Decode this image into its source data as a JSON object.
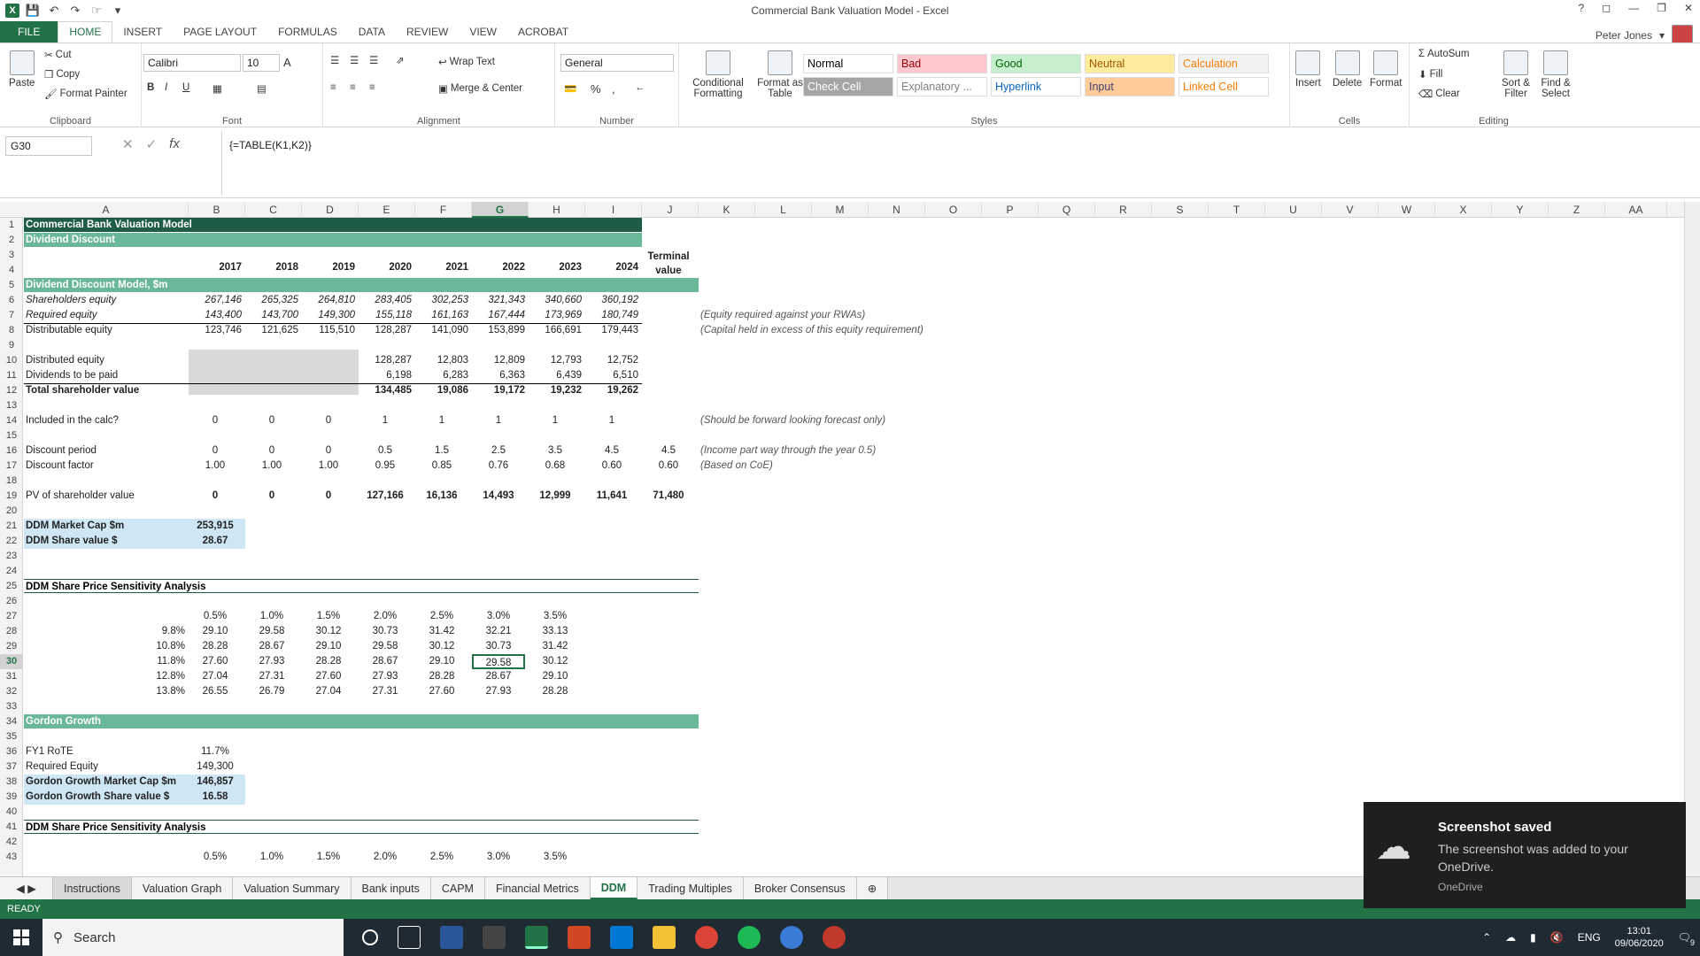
{
  "window": {
    "title": "Commercial Bank Valuation Model - Excel",
    "user": "Peter Jones",
    "help": "?"
  },
  "ribbon_tabs": [
    "FILE",
    "HOME",
    "INSERT",
    "PAGE LAYOUT",
    "FORMULAS",
    "DATA",
    "REVIEW",
    "VIEW",
    "ACROBAT"
  ],
  "clipboard": {
    "paste": "Paste",
    "cut": "Cut",
    "copy": "Copy",
    "format_painter": "Format Painter",
    "label": "Clipboard"
  },
  "font": {
    "name": "Calibri",
    "size": "10",
    "bold": "B",
    "italic": "I",
    "underline": "U",
    "grow": "A",
    "label": "Font"
  },
  "alignment": {
    "wrap": "Wrap Text",
    "merge": "Merge & Center",
    "label": "Alignment"
  },
  "number": {
    "format": "General",
    "percent": "%",
    "comma": ",",
    "label": "Number"
  },
  "styles": {
    "cond": "Conditional Formatting",
    "table": "Format as Table",
    "label": "Styles",
    "items": [
      {
        "name": "Normal",
        "bg": "#ffffff",
        "fg": "#000000"
      },
      {
        "name": "Bad",
        "bg": "#ffc7ce",
        "fg": "#9c0006"
      },
      {
        "name": "Good",
        "bg": "#c6efce",
        "fg": "#006100"
      },
      {
        "name": "Neutral",
        "bg": "#ffeb9c",
        "fg": "#9c5700"
      },
      {
        "name": "Calculation",
        "bg": "#f2f2f2",
        "fg": "#fa7d00"
      },
      {
        "name": "Check Cell",
        "bg": "#a5a5a5",
        "fg": "#ffffff"
      },
      {
        "name": "Explanatory ...",
        "bg": "#ffffff",
        "fg": "#7f7f7f"
      },
      {
        "name": "Hyperlink",
        "bg": "#ffffff",
        "fg": "#0563c1"
      },
      {
        "name": "Input",
        "bg": "#ffcc99",
        "fg": "#3f3f76"
      },
      {
        "name": "Linked Cell",
        "bg": "#ffffff",
        "fg": "#fa7d00"
      }
    ]
  },
  "cells_group": {
    "insert": "Insert",
    "delete": "Delete",
    "format": "Format",
    "label": "Cells"
  },
  "editing": {
    "autosum": "AutoSum",
    "fill": "Fill",
    "clear": "Clear",
    "sort": "Sort & Filter",
    "find": "Find & Select",
    "label": "Editing"
  },
  "formula_bar": {
    "name_box": "G30",
    "formula": "{=TABLE(K1,K2)}",
    "fx": "fx"
  },
  "columns": [
    "A",
    "B",
    "C",
    "D",
    "E",
    "F",
    "G",
    "H",
    "I",
    "J",
    "K",
    "L",
    "M",
    "N",
    "O",
    "P",
    "Q",
    "R",
    "S",
    "T",
    "U",
    "V",
    "W",
    "X",
    "Y",
    "Z",
    "AA"
  ],
  "rows": [
    "1",
    "2",
    "3",
    "4",
    "5",
    "6",
    "7",
    "8",
    "9",
    "10",
    "11",
    "12",
    "13",
    "14",
    "15",
    "16",
    "17",
    "18",
    "19",
    "20",
    "21",
    "22",
    "23",
    "24",
    "25",
    "26",
    "27",
    "28",
    "29",
    "30",
    "31",
    "32",
    "33",
    "34",
    "35",
    "36",
    "37",
    "38",
    "39",
    "40",
    "41",
    "42",
    "43"
  ],
  "sheet": {
    "title": "Commercial Bank Valuation Model",
    "subtitle": "Dividend Discount",
    "years": [
      "2017",
      "2018",
      "2019",
      "2020",
      "2021",
      "2022",
      "2023",
      "2024"
    ],
    "terminal_1": "Terminal",
    "terminal_2": "value",
    "ddm_header": "Dividend Discount Model, $m",
    "r6": {
      "label": "Shareholders equity",
      "v": [
        "267,146",
        "265,325",
        "264,810",
        "283,405",
        "302,253",
        "321,343",
        "340,660",
        "360,192"
      ]
    },
    "r7": {
      "label": "Required equity",
      "v": [
        "143,400",
        "143,700",
        "149,300",
        "155,118",
        "161,163",
        "167,444",
        "173,969",
        "180,749"
      ],
      "note": "(Equity required against your RWAs)"
    },
    "r8": {
      "label": "Distributable equity",
      "v": [
        "123,746",
        "121,625",
        "115,510",
        "128,287",
        "141,090",
        "153,899",
        "166,691",
        "179,443"
      ],
      "note": "(Capital held in excess of this equity requirement)"
    },
    "r10": {
      "label": "Distributed equity",
      "v": [
        "128,287",
        "12,803",
        "12,809",
        "12,793",
        "12,752"
      ]
    },
    "r11": {
      "label": "Dividends to be paid",
      "v": [
        "6,198",
        "6,283",
        "6,363",
        "6,439",
        "6,510"
      ]
    },
    "r12": {
      "label": "Total shareholder value",
      "v": [
        "134,485",
        "19,086",
        "19,172",
        "19,232",
        "19,262"
      ]
    },
    "r14": {
      "label": "Included in the calc?",
      "v": [
        "0",
        "0",
        "0",
        "1",
        "1",
        "1",
        "1",
        "1"
      ],
      "note": "(Should be forward looking forecast only)"
    },
    "r16": {
      "label": "Discount period",
      "v": [
        "0",
        "0",
        "0",
        "0.5",
        "1.5",
        "2.5",
        "3.5",
        "4.5",
        "4.5"
      ],
      "note": "(Income part way through the year 0.5)"
    },
    "r17": {
      "label": "Discount factor",
      "v": [
        "1.00",
        "1.00",
        "1.00",
        "0.95",
        "0.85",
        "0.76",
        "0.68",
        "0.60",
        "0.60"
      ],
      "note": "(Based on CoE)"
    },
    "r19": {
      "label": "PV of shareholder value",
      "v": [
        "0",
        "0",
        "0",
        "127,166",
        "16,136",
        "14,493",
        "12,999",
        "11,641",
        "71,480"
      ]
    },
    "r21": {
      "label": "DDM Market Cap $m",
      "v": "253,915"
    },
    "r22": {
      "label": "DDM Share value $",
      "v": "28.67"
    },
    "sens_header": "DDM Share Price Sensitivity Analysis",
    "sens_cols": [
      "0.5%",
      "1.0%",
      "1.5%",
      "2.0%",
      "2.5%",
      "3.0%",
      "3.5%"
    ],
    "sens_rows": [
      {
        "k": "9.8%",
        "v": [
          "29.10",
          "29.58",
          "30.12",
          "30.73",
          "31.42",
          "32.21",
          "33.13"
        ]
      },
      {
        "k": "10.8%",
        "v": [
          "28.28",
          "28.67",
          "29.10",
          "29.58",
          "30.12",
          "30.73",
          "31.42"
        ]
      },
      {
        "k": "11.8%",
        "v": [
          "27.60",
          "27.93",
          "28.28",
          "28.67",
          "29.10",
          "29.58",
          "30.12"
        ]
      },
      {
        "k": "12.8%",
        "v": [
          "27.04",
          "27.31",
          "27.60",
          "27.93",
          "28.28",
          "28.67",
          "29.10"
        ]
      },
      {
        "k": "13.8%",
        "v": [
          "26.55",
          "26.79",
          "27.04",
          "27.31",
          "27.60",
          "27.93",
          "28.28"
        ]
      }
    ],
    "gordon_header": "Gordon Growth",
    "r36": {
      "label": "FY1 RoTE",
      "v": "11.7%"
    },
    "r37": {
      "label": "Required Equity",
      "v": "149,300"
    },
    "r38": {
      "label": "Gordon Growth Market Cap $m",
      "v": "146,857"
    },
    "r39": {
      "label": "Gordon Growth Share value $",
      "v": "16.58"
    },
    "sens2_header": "DDM Share Price Sensitivity Analysis",
    "r43_partial": [
      "0.5%",
      "1.0%",
      "1.5%",
      "2.0%",
      "2.5%",
      "3.0%",
      "3.5%"
    ]
  },
  "sheet_tabs": [
    "Instructions",
    "Valuation Graph",
    "Valuation Summary",
    "Bank inputs",
    "CAPM",
    "Financial Metrics",
    "DDM",
    "Trading Multiples",
    "Broker Consensus"
  ],
  "active_sheet": "DDM",
  "status": "READY",
  "taskbar": {
    "search": "Search",
    "lang": "ENG",
    "time": "13:01",
    "date": "09/06/2020",
    "badge": "9"
  },
  "toast": {
    "title": "Screenshot saved",
    "body": "The screenshot was added to your OneDrive.",
    "source": "OneDrive"
  }
}
